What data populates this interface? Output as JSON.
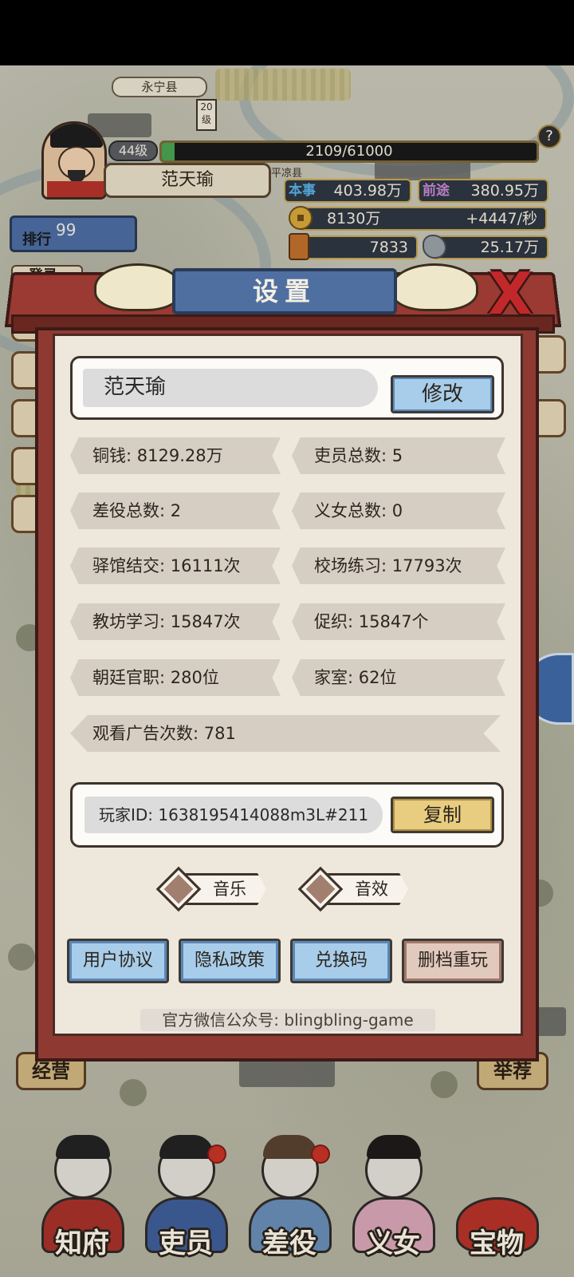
{
  "map": {
    "town_label": "永宁县",
    "town_label2": "平凉县",
    "level_tag": "20级"
  },
  "hud": {
    "level": "44级",
    "xp_text": "2109/61000",
    "xp_fraction": 0.0346,
    "player_name": "范天瑜",
    "skill_tag": "本事",
    "skill_value": "403.98万",
    "merit_tag": "前途",
    "merit_value": "380.95万",
    "coin_value": "8130万",
    "coin_rate": "+4447/秒",
    "grain_value": "7833",
    "stone_value": "25.17万",
    "rank_value": "99",
    "rank_label": "排行",
    "side_label": "登录",
    "help_label": "?"
  },
  "dialog": {
    "title": "设置",
    "close_label": "X",
    "name_value": "范天瑜",
    "modify_label": "修改",
    "stats": [
      "铜钱: 8129.28万",
      "吏员总数: 5",
      "差役总数: 2",
      "义女总数: 0",
      "驿馆结交: 16111次",
      "校场练习: 17793次",
      "教坊学习: 15847次",
      "促织: 15847个",
      "朝廷官职: 280位",
      "家室: 62位",
      "观看广告次数: 781"
    ],
    "player_id": "玩家ID: 1638195414088m3L#211",
    "copy_label": "复制",
    "music_label": "音乐",
    "sfx_label": "音效",
    "buttons": [
      "用户协议",
      "隐私政策",
      "兑换码",
      "删档重玩"
    ],
    "wechat": "官方微信公众号: blingbling-game"
  },
  "side": {
    "bottom_left": "经营",
    "bottom_right": "举荐"
  },
  "nav": {
    "items": [
      "知府",
      "吏员",
      "差役",
      "义女",
      "宝物"
    ]
  },
  "colors": {
    "dialog_frame": "#8e3a33",
    "dialog_panel": "#eee7dc",
    "button_blue": "#a8cdea",
    "button_gold": "#e8cc80",
    "close_red": "#c2282a"
  }
}
